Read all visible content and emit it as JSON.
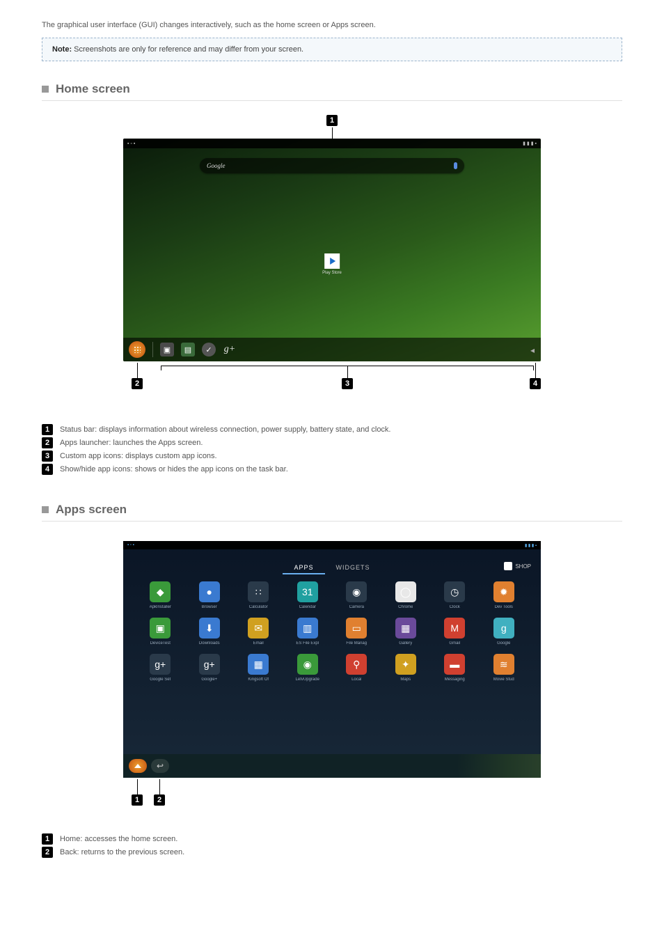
{
  "intro": "The graphical user interface (GUI) changes interactively, such as the home screen or Apps screen.",
  "note": {
    "label": "Note:",
    "text": " Screenshots are only for reference and may differ from your screen."
  },
  "sections": {
    "home": "Home screen",
    "apps": "Apps screen"
  },
  "home_shot": {
    "search_label": "Google",
    "play_label": "Play Store"
  },
  "home_legend": [
    {
      "n": "1",
      "t": "Status bar: displays information about wireless connection, power supply, battery state, and clock."
    },
    {
      "n": "2",
      "t": "Apps launcher: launches the Apps screen."
    },
    {
      "n": "3",
      "t": "Custom app icons: displays custom app icons."
    },
    {
      "n": "4",
      "t": "Show/hide app icons: shows or hides the app icons on the task bar."
    }
  ],
  "apps_tabs": {
    "apps": "APPS",
    "widgets": "WIDGETS",
    "shop": "SHOP"
  },
  "apps_grid": [
    {
      "l": "ApkInstaller",
      "c": "c-gr",
      "g": "◆"
    },
    {
      "l": "Browser",
      "c": "c-bl",
      "g": "●"
    },
    {
      "l": "Calculator",
      "c": "c-dk",
      "g": "∷"
    },
    {
      "l": "Calendar",
      "c": "c-te",
      "g": "31"
    },
    {
      "l": "Camera",
      "c": "c-dk",
      "g": "◉"
    },
    {
      "l": "Chrome",
      "c": "c-wh",
      "g": "◯"
    },
    {
      "l": "Clock",
      "c": "c-dk",
      "g": "◷"
    },
    {
      "l": "Dev Tools",
      "c": "c-or",
      "g": "✹"
    },
    {
      "l": "DeviceTest",
      "c": "c-gr",
      "g": "▣"
    },
    {
      "l": "Downloads",
      "c": "c-bl",
      "g": "⬇"
    },
    {
      "l": "Email",
      "c": "c-ye",
      "g": "✉"
    },
    {
      "l": "ES File Expl",
      "c": "c-bl",
      "g": "▥"
    },
    {
      "l": "File Manag",
      "c": "c-or",
      "g": "▭"
    },
    {
      "l": "Gallery",
      "c": "c-pu",
      "g": "▦"
    },
    {
      "l": "Gmail",
      "c": "c-re",
      "g": "M"
    },
    {
      "l": "Google",
      "c": "c-cy",
      "g": "g"
    },
    {
      "l": "Google Set",
      "c": "c-dk",
      "g": "g+"
    },
    {
      "l": "Google+",
      "c": "c-dk",
      "g": "g+"
    },
    {
      "l": "Kingsoft Of",
      "c": "c-bl",
      "g": "▦"
    },
    {
      "l": "LetvUpgrade",
      "c": "c-gr",
      "g": "◉"
    },
    {
      "l": "Local",
      "c": "c-re",
      "g": "⚲"
    },
    {
      "l": "Maps",
      "c": "c-ye",
      "g": "✦"
    },
    {
      "l": "Messaging",
      "c": "c-re",
      "g": "▬"
    },
    {
      "l": "Movie Stud",
      "c": "c-or",
      "g": "≋"
    }
  ],
  "apps_legend": [
    {
      "n": "1",
      "t": "Home: accesses the home screen."
    },
    {
      "n": "2",
      "t": "Back: returns to the previous screen."
    }
  ]
}
